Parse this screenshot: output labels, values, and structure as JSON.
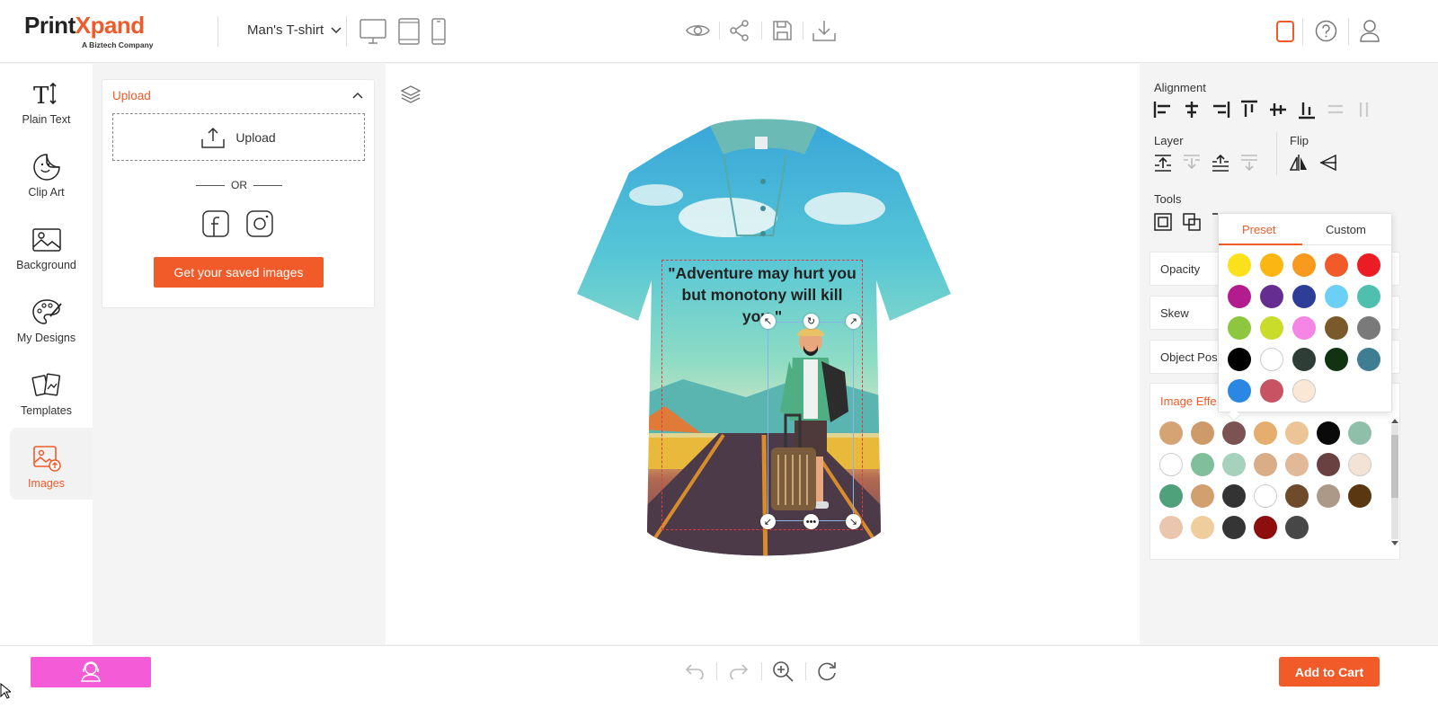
{
  "header": {
    "logo_part1": "Print",
    "logo_part2": "Xpand",
    "logo_tagline": "A Biztech Company",
    "product_name": "Man's T-shirt",
    "device_icons": [
      "desktop-icon",
      "tablet-icon",
      "mobile-icon"
    ],
    "action_icons": [
      "preview-eye-icon",
      "share-icon",
      "save-icon",
      "download-icon"
    ],
    "right_icons": [
      "color-swatch-icon",
      "help-icon",
      "user-icon"
    ]
  },
  "sidebar": {
    "items": [
      {
        "label": "Plain Text",
        "icon": "text-icon"
      },
      {
        "label": "Clip Art",
        "icon": "clipart-icon"
      },
      {
        "label": "Background",
        "icon": "background-icon"
      },
      {
        "label": "My Designs",
        "icon": "palette-icon"
      },
      {
        "label": "Templates",
        "icon": "templates-icon"
      },
      {
        "label": "Images",
        "icon": "images-icon",
        "active": true
      }
    ]
  },
  "upload_panel": {
    "title": "Upload",
    "upload_label": "Upload",
    "or_label": "OR",
    "social_icons": [
      "facebook-icon",
      "instagram-icon"
    ],
    "saved_button": "Get your saved images"
  },
  "canvas": {
    "quote_text": "\"Adventure may hurt you but monotony will kill you.\""
  },
  "right_panel": {
    "alignment_title": "Alignment",
    "layer_title": "Layer",
    "flip_title": "Flip",
    "tools_title": "Tools",
    "accordions": [
      "Opacity",
      "Skew",
      "Object Pos"
    ],
    "effects_title": "Image Effe",
    "effect_swatches": [
      "#d4a475",
      "#cf9a69",
      "#7b5353",
      "#e6ae6e",
      "#ecc596",
      "#0a0a0a",
      "#8fbfa9",
      "#ffffff",
      "#7fbf9b",
      "#a5d1bd",
      "#d9ad88",
      "#e1b898",
      "#6a4141",
      "#f3e3d6",
      "#4fa17b",
      "#d29f6f",
      "#333333",
      "#ffffff",
      "#6e4c2b",
      "#ad9987",
      "#5a3710",
      "#e9c6ad",
      "#efcd9d",
      "#353535",
      "#8e0d0d",
      "#474747"
    ]
  },
  "color_popup": {
    "tab_preset": "Preset",
    "tab_custom": "Custom",
    "active_tab": "Preset",
    "preset_colors": [
      "#fbe11b",
      "#fbb614",
      "#f79a1e",
      "#f15a29",
      "#ec1c24",
      "#b31c8e",
      "#662d91",
      "#2e3d98",
      "#6ccff6",
      "#4fc0b0",
      "#8dc63f",
      "#c9dc2b",
      "#f586e6",
      "#7a5a2a",
      "#7a7a7a",
      "#000000",
      "#ffffff",
      "#2e3e37",
      "#123311",
      "#3e7d92",
      "#2a88e2",
      "#c75363",
      "#fbe7d6"
    ]
  },
  "footer": {
    "left_button_icon": "customer-support-icon",
    "tools": [
      "undo-icon",
      "redo-icon",
      "zoom-in-icon",
      "refresh-icon"
    ],
    "add_to_cart": "Add to Cart"
  }
}
